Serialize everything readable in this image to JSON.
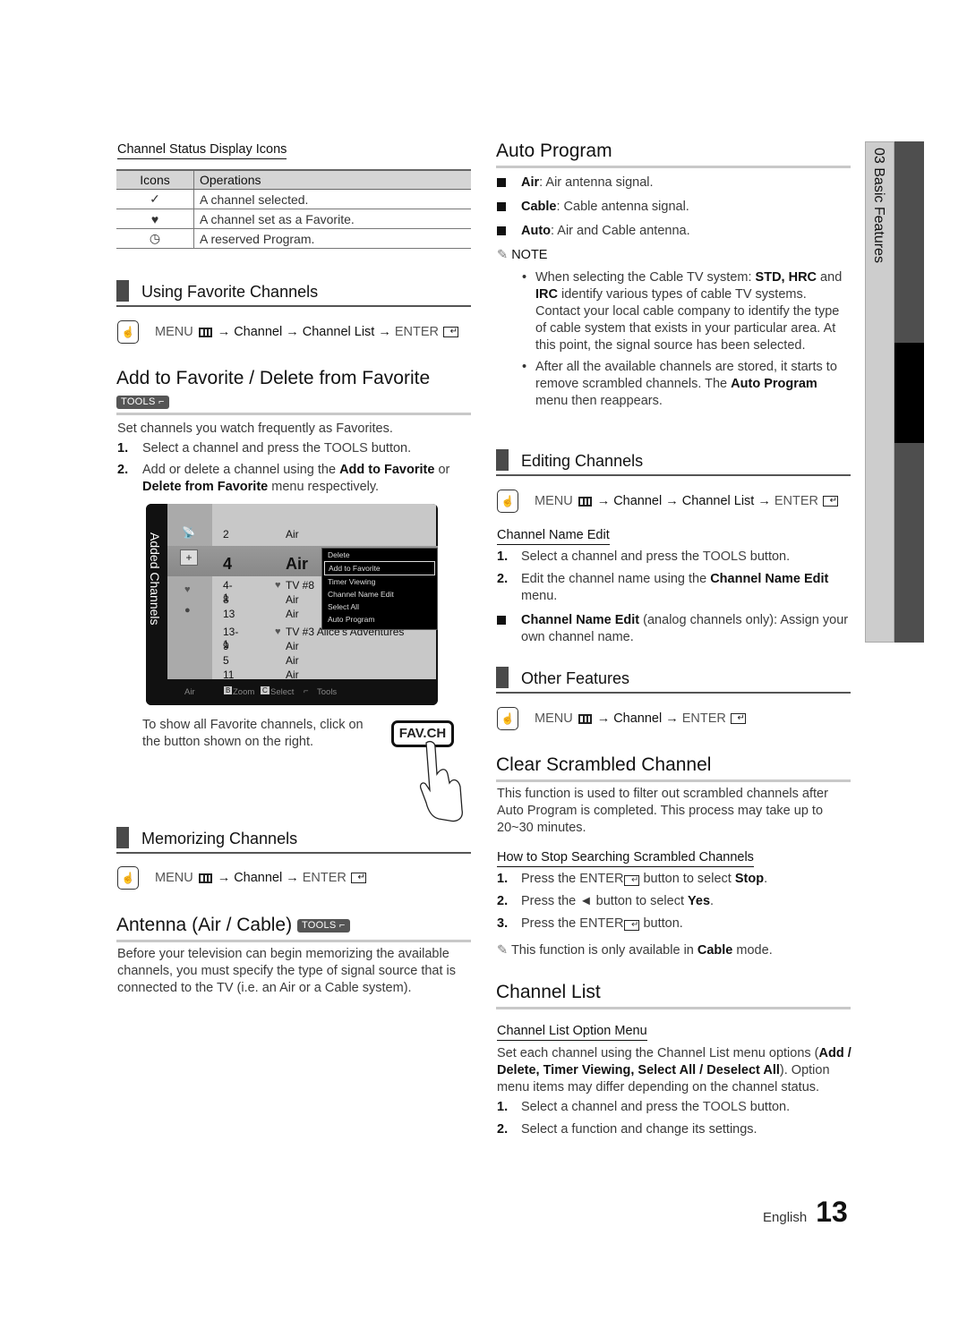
{
  "page": {
    "language": "English",
    "number": "13"
  },
  "side_tab": {
    "label": "03   Basic Features"
  },
  "status_icons": {
    "title": "Channel Status Display Icons",
    "headers": [
      "Icons",
      "Operations"
    ],
    "rows": [
      {
        "icon": "✓",
        "icon_name": "checkmark-icon",
        "text": "A channel selected."
      },
      {
        "icon": "♥",
        "icon_name": "heart-icon",
        "text": "A channel set as a Favorite."
      },
      {
        "icon": "◷",
        "icon_name": "clock-icon",
        "text": "A reserved Program."
      }
    ]
  },
  "using_favorite": {
    "heading": "Using Favorite Channels",
    "menu_path": {
      "menu": "MENU",
      "a1": "→",
      "p1": "Channel",
      "a2": "→",
      "p2": "Channel List",
      "a3": "→",
      "enter": "ENTER"
    }
  },
  "add_favorite": {
    "title": "Add to Favorite / Delete from Favorite",
    "tools": "TOOLS",
    "intro": "Set channels you watch frequently as Favorites.",
    "step1": {
      "num": "1.",
      "a": "Select a channel and press the ",
      "b": "TOOLS",
      "c": " button."
    },
    "step2": {
      "num": "2.",
      "a": "Add or delete a channel using the ",
      "b": "Add to Favorite",
      "c": " or ",
      "d": "Delete from Favorite",
      "e": " menu respectively."
    },
    "favch_text": "To show all Favorite channels, click on the button shown on the right.",
    "favch_button": "FAV.CH"
  },
  "tv_screen": {
    "side_label": "Added Channels",
    "channels": [
      {
        "num": "2",
        "name": "Air",
        "fav": false
      },
      {
        "num": "4",
        "name": "Air",
        "fav": false,
        "selected": true
      },
      {
        "num": "4-1",
        "name": "TV #8",
        "fav": true
      },
      {
        "num": "8",
        "name": "Air",
        "fav": false
      },
      {
        "num": "13",
        "name": "Air",
        "fav": false
      },
      {
        "num": "13-1",
        "name": "TV #3 Alice's Adventures",
        "fav": true
      },
      {
        "num": "9",
        "name": "Air",
        "fav": false
      },
      {
        "num": "5",
        "name": "Air",
        "fav": false
      },
      {
        "num": "11",
        "name": "Air",
        "fav": false
      }
    ],
    "tools_menu": [
      "Delete",
      "Add to Favorite",
      "Timer Viewing",
      "Channel Name Edit",
      "Select All",
      "Auto Program"
    ],
    "tools_menu_highlighted": "Add to Favorite",
    "footer": {
      "source": "Air",
      "b_key": "B",
      "zoom": "Zoom",
      "c_key": "C",
      "select": "Select",
      "tools": "Tools"
    }
  },
  "memorizing": {
    "heading": "Memorizing Channels",
    "menu_path": {
      "menu": "MENU",
      "a1": "→",
      "p1": "Channel",
      "a2": "→",
      "enter": "ENTER"
    }
  },
  "antenna": {
    "title": "Antenna (Air / Cable)",
    "tools": "TOOLS",
    "body": "Before your television can begin memorizing the available channels, you must specify the type of signal source that is connected to the TV (i.e. an Air or a Cable system)."
  },
  "auto_program": {
    "title": "Auto Program",
    "items": [
      {
        "b": "Air",
        "t": ": Air antenna signal."
      },
      {
        "b": "Cable",
        "t": ": Cable antenna signal."
      },
      {
        "b": "Auto",
        "t": ": Air and Cable antenna."
      }
    ],
    "note_label": "NOTE",
    "note1": {
      "a": "When selecting the Cable TV system: ",
      "b": "STD, HRC",
      "c": " and ",
      "d": "IRC",
      "e": " identify various types of cable TV systems. Contact your local cable company to identify the type of cable system that exists in your particular area. At this point, the signal source has been selected."
    },
    "note2": {
      "a": "After all the available channels are stored, it starts to remove scrambled channels. The ",
      "b": "Auto Program",
      "c": " menu then reappears."
    }
  },
  "editing": {
    "heading": "Editing Channels",
    "menu_path": {
      "menu": "MENU",
      "a1": "→",
      "p1": "Channel",
      "a2": "→",
      "p2": "Channel List",
      "a3": "→",
      "enter": "ENTER"
    },
    "subheading": "Channel Name Edit",
    "step1": {
      "num": "1.",
      "a": "Select a channel and press the ",
      "b": "TOOLS",
      "c": " button."
    },
    "step2": {
      "num": "2.",
      "a": "Edit the channel name using the ",
      "b": "Channel Name Edit",
      "c": " menu."
    },
    "bullet": {
      "b": "Channel Name Edit",
      "t": " (analog channels only): Assign your own channel name."
    }
  },
  "other": {
    "heading": "Other Features",
    "menu_path": {
      "menu": "MENU",
      "a1": "→",
      "p1": "Channel",
      "a2": "→",
      "enter": "ENTER"
    }
  },
  "clear_scrambled": {
    "title": "Clear Scrambled Channel",
    "body": "This function is used to filter out scrambled channels after Auto Program is completed. This process may take up to 20~30 minutes.",
    "subheading": "How to Stop Searching Scrambled Channels",
    "step1": {
      "num": "1.",
      "a": "Press the ",
      "b": "ENTER",
      "c": " button to select ",
      "d": "Stop",
      "e": "."
    },
    "step2": {
      "num": "2.",
      "a": "Press the ◄ button to select ",
      "b": "Yes",
      "c": "."
    },
    "step3": {
      "num": "3.",
      "a": "Press the ",
      "b": "ENTER",
      "c": " button."
    },
    "note": {
      "a": "This function is only available in ",
      "b": "Cable",
      "c": " mode."
    }
  },
  "channel_list": {
    "title": "Channel List",
    "subheading": "Channel List Option Menu",
    "body": {
      "a": "Set each channel using the Channel List menu options (",
      "b": "Add / Delete, Timer Viewing, Select All / Deselect All",
      "c": "). Option menu items may differ depending on the channel status."
    },
    "step1": {
      "num": "1.",
      "a": "Select a channel and press the ",
      "b": "TOOLS",
      "c": " button."
    },
    "step2": {
      "num": "2.",
      "a": "Select a function and change its settings."
    }
  }
}
